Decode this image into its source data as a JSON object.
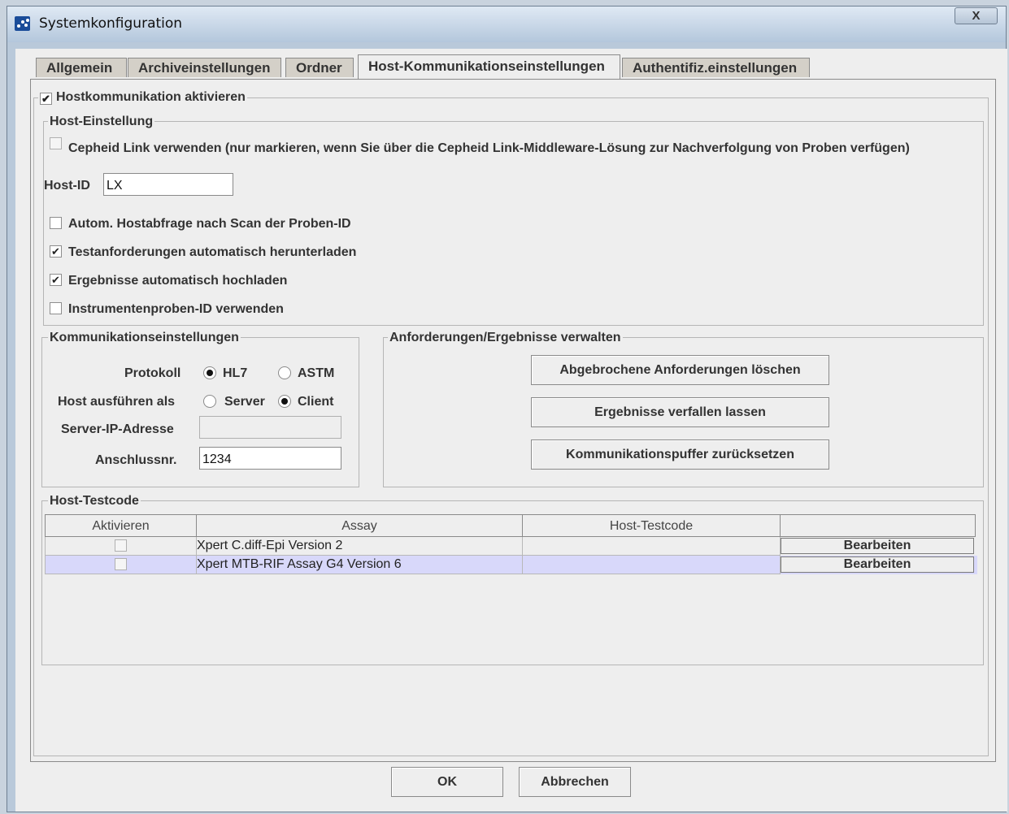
{
  "window": {
    "title": "Systemkonfiguration",
    "close_glyph": "X",
    "icon": "app-dots-icon"
  },
  "tabs": [
    {
      "label": "Allgemein"
    },
    {
      "label": "Archiveinstellungen"
    },
    {
      "label": "Ordner"
    },
    {
      "label": "Host-Kommunikationseinstellungen",
      "active": true
    },
    {
      "label": "Authentifiz.einstellungen"
    }
  ],
  "host_comm": {
    "label": "Hostkommunikation aktivieren",
    "checked": true
  },
  "host_setting": {
    "legend": "Host-Einstellung",
    "cepheid_link": {
      "label": "Cepheid Link verwenden (nur markieren, wenn Sie über die Cepheid Link-Middleware-Lösung zur Nachverfolgung von Proben verfügen)",
      "checked": false
    },
    "host_id_label": "Host-ID",
    "host_id_value": "LX",
    "options": [
      {
        "label": "Autom. Hostabfrage nach Scan der Proben-ID",
        "checked": false
      },
      {
        "label": "Testanforderungen automatisch herunterladen",
        "checked": true
      },
      {
        "label": "Ergebnisse automatisch hochladen",
        "checked": true
      },
      {
        "label": "Instrumentenproben-ID verwenden",
        "checked": false
      }
    ]
  },
  "comm_settings": {
    "legend": "Kommunikationseinstellungen",
    "protocol_label": "Protokoll",
    "protocol_hl7": "HL7",
    "protocol_astm": "ASTM",
    "protocol_selected": "HL7",
    "host_mode_label": "Host ausführen als",
    "host_mode_server": "Server",
    "host_mode_client": "Client",
    "host_mode_selected": "Client",
    "server_ip_label": "Server-IP-Adresse",
    "server_ip_value": "",
    "port_label": "Anschlussnr.",
    "port_value": "1234"
  },
  "manage": {
    "legend": "Anforderungen/Ergebnisse verwalten",
    "btn_delete": "Abgebrochene Anforderungen löschen",
    "btn_expire": "Ergebnisse verfallen lassen",
    "btn_reset": "Kommunikationspuffer zurücksetzen"
  },
  "testcode": {
    "legend": "Host-Testcode",
    "columns": [
      "Aktivieren",
      "Assay",
      "Host-Testcode",
      ""
    ],
    "rows": [
      {
        "enabled": false,
        "assay": "Xpert C.diff-Epi Version 2",
        "host_testcode": "",
        "action": "Bearbeiten",
        "selected": false
      },
      {
        "enabled": false,
        "assay": "Xpert MTB-RIF Assay G4 Version 6",
        "host_testcode": "",
        "action": "Bearbeiten",
        "selected": true
      }
    ]
  },
  "footer": {
    "ok": "OK",
    "cancel": "Abbrechen"
  }
}
